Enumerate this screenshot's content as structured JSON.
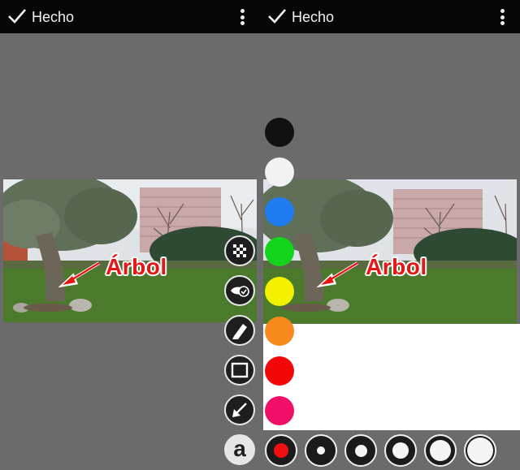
{
  "left": {
    "toolbar": {
      "done_label": "Hecho"
    },
    "photo_label": "Árbol",
    "tools": [
      {
        "name": "pixelate-tool",
        "icon": "mosaic-icon"
      },
      {
        "name": "highlight-tool",
        "icon": "eye-check-icon"
      },
      {
        "name": "pen-tool",
        "icon": "marker-icon"
      },
      {
        "name": "rectangle-tool",
        "icon": "rectangle-icon"
      },
      {
        "name": "arrow-tool",
        "icon": "arrow-icon"
      },
      {
        "name": "text-tool",
        "icon": "text-a-icon",
        "glyph": "a",
        "active": true
      }
    ]
  },
  "right": {
    "toolbar": {
      "done_label": "Hecho"
    },
    "photo_label": "Árbol",
    "colors": [
      {
        "name": "black",
        "hex": "#111111"
      },
      {
        "name": "white",
        "hex": "#f2f2f2"
      },
      {
        "name": "blue",
        "hex": "#1f7bf0"
      },
      {
        "name": "green",
        "hex": "#15d41e"
      },
      {
        "name": "yellow",
        "hex": "#f3f000"
      },
      {
        "name": "orange",
        "hex": "#f7891d"
      },
      {
        "name": "red",
        "hex": "#f20808"
      },
      {
        "name": "pink",
        "hex": "#f0106a"
      }
    ],
    "sizes": [
      {
        "level": 0,
        "selected": true
      },
      {
        "level": 1
      },
      {
        "level": 2
      },
      {
        "level": 3
      },
      {
        "level": 4
      },
      {
        "level": 5
      }
    ]
  },
  "accent_colors": {
    "bar": "#070707",
    "canvas": "#6b6b6b",
    "label_red": "#e61616"
  }
}
